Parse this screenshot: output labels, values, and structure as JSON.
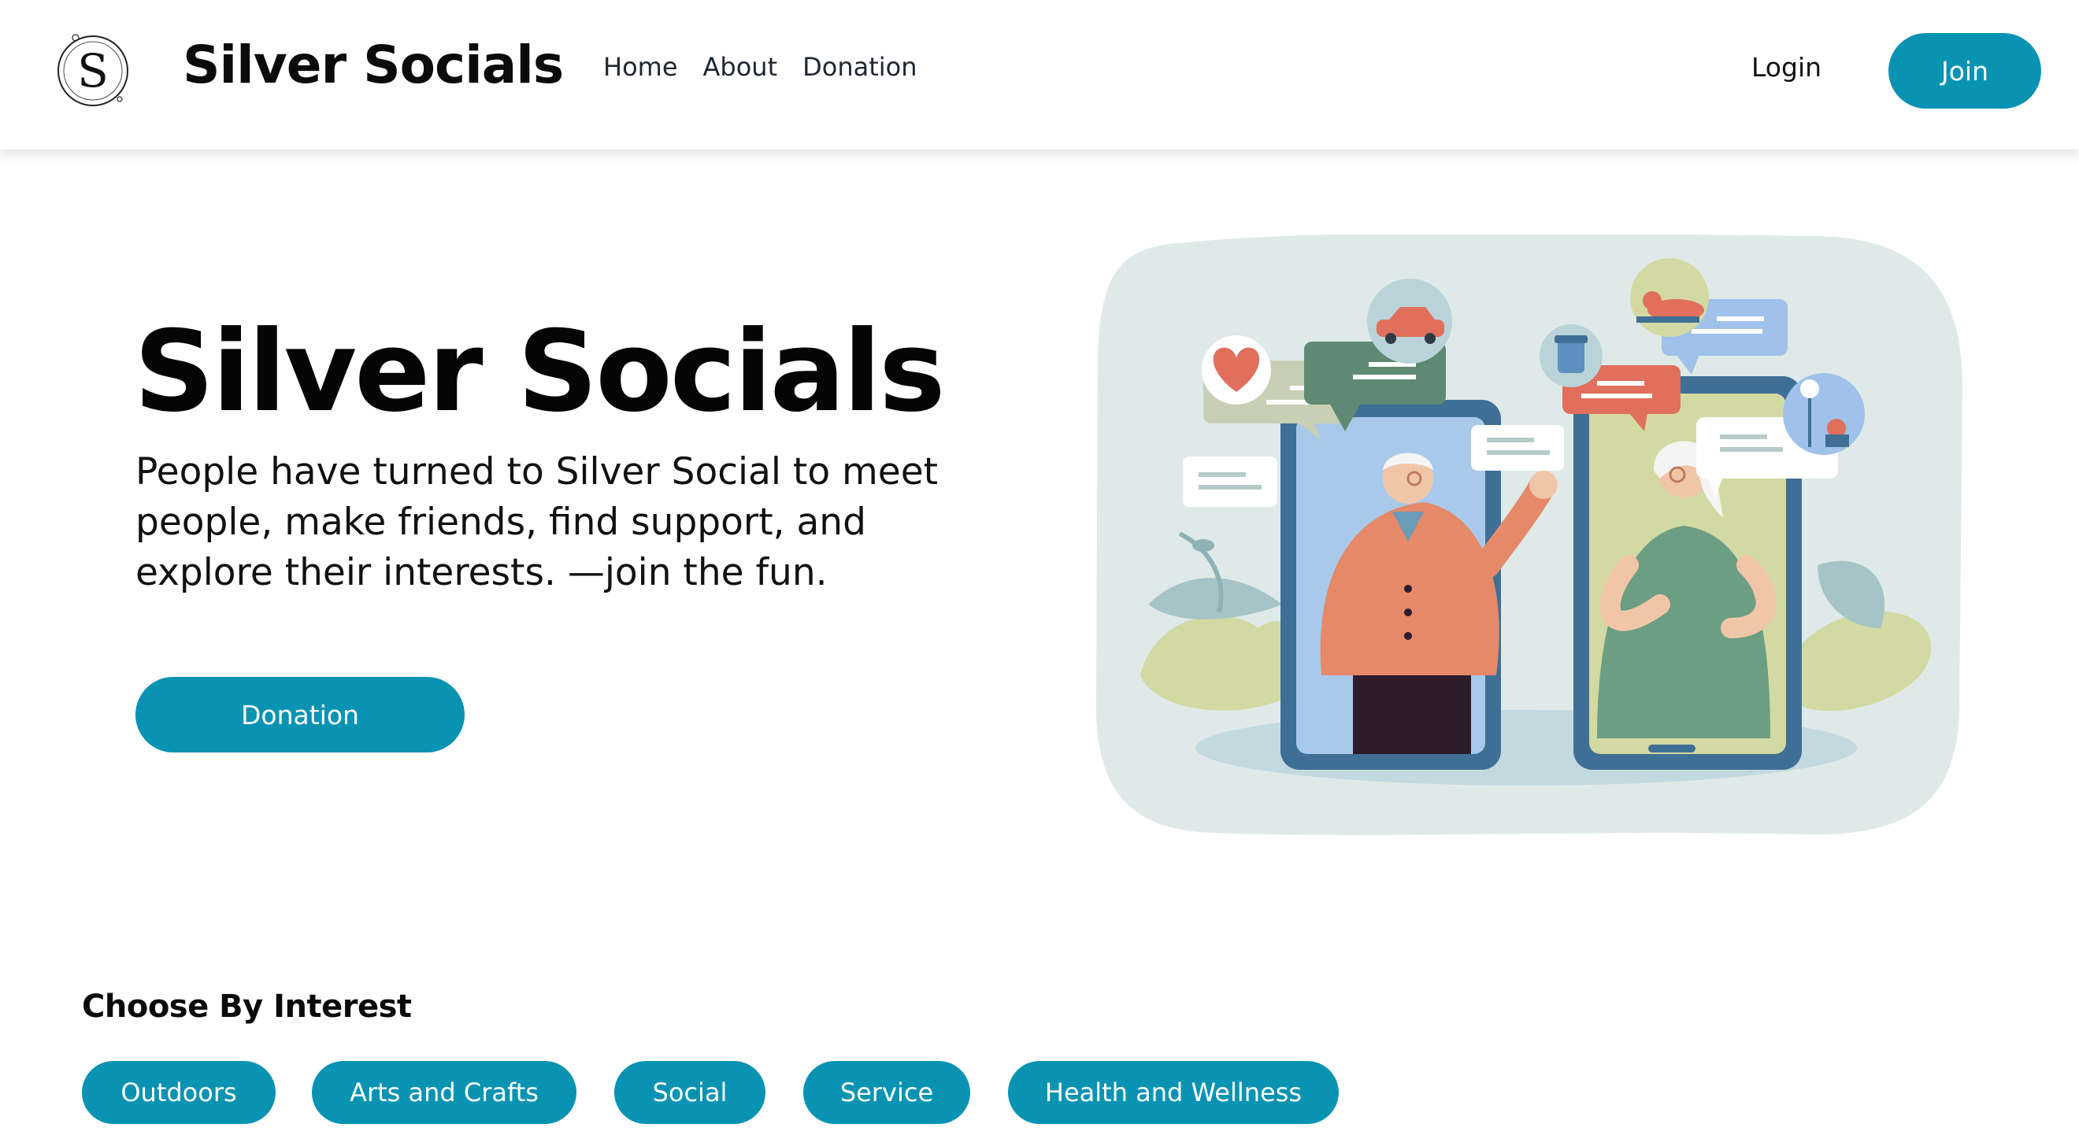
{
  "header": {
    "brand": "Silver Socials",
    "logo_letter": "S",
    "nav": [
      "Home",
      "About",
      "Donation"
    ],
    "login_label": "Login",
    "join_label": "Join"
  },
  "hero": {
    "title": "Silver Socials",
    "description": "People have turned to Silver Social to meet people, make friends, find support, and explore their interests. —join the fun.",
    "donation_label": "Donation"
  },
  "interests": {
    "heading": "Choose By Interest",
    "chips": [
      "Outdoors",
      "Arts and Crafts",
      "Social",
      "Service",
      "Health and Wellness"
    ]
  },
  "colors": {
    "accent": "#0893b3",
    "illustration_bg": "#dfeae8"
  },
  "illustration_icons": [
    "heart-icon",
    "car-icon",
    "jar-icon",
    "cat-icon",
    "tree-icon",
    "chat-bubble-icon"
  ]
}
